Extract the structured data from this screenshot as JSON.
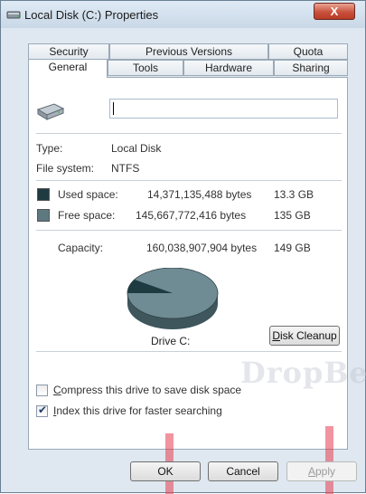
{
  "window": {
    "title": "Local Disk (C:) Properties",
    "close_label": "X"
  },
  "tabs_row1": [
    {
      "label": "Security"
    },
    {
      "label": "Previous Versions"
    },
    {
      "label": "Quota"
    }
  ],
  "tabs_row2": [
    {
      "label": "General",
      "active": true
    },
    {
      "label": "Tools"
    },
    {
      "label": "Hardware"
    },
    {
      "label": "Sharing"
    }
  ],
  "general": {
    "volume_name": "",
    "type_label": "Type:",
    "type_value": "Local Disk",
    "fs_label": "File system:",
    "fs_value": "NTFS",
    "used_label": "Used space:",
    "used_bytes": "14,371,135,488 bytes",
    "used_size": "13.3 GB",
    "free_label": "Free space:",
    "free_bytes": "145,667,772,416 bytes",
    "free_size": "135 GB",
    "capacity_label": "Capacity:",
    "capacity_bytes": "160,038,907,904 bytes",
    "capacity_size": "149 GB",
    "drive_label": "Drive C:",
    "disk_cleanup_label": "Disk Cleanup",
    "disk_cleanup_mnemonic": "D",
    "disk_cleanup_rest": "isk Cleanup",
    "compress_mnemonic": "C",
    "compress_rest": "ompress this drive to save disk space",
    "compress_checked": false,
    "index_mnemonic": "I",
    "index_rest": "ndex this drive for faster searching",
    "index_checked": true
  },
  "colors": {
    "used": "#1f3b42",
    "free": "#5e7880",
    "accent": "#1f3f6a"
  },
  "usage_fraction_used": 0.0898,
  "footer": {
    "ok_label": "OK",
    "cancel_label": "Cancel",
    "apply_mnemonic": "A",
    "apply_rest": "pply"
  },
  "watermark": "DropBe"
}
